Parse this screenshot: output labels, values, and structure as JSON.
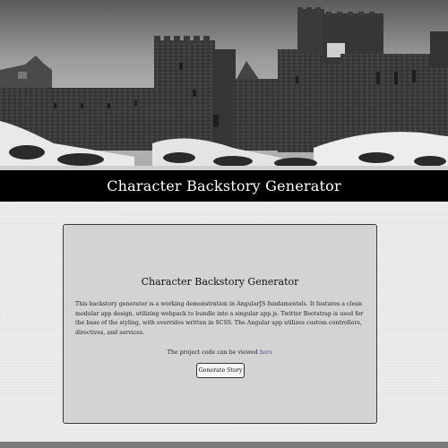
{
  "header": {
    "title": "Character Backstory Generator"
  },
  "hero": {
    "image": "castle-ruins-photo"
  },
  "card": {
    "title": "Character Backstory Generator",
    "description": "This backstory generator is a working demonstration in AngularJS fundamentals. It features a clean modular app design, utilizing webpack to bundle into a singular app.js. Twitter Bootstrap is used for the base of the styling, with overrides written in SCSS. The Angular app utilizes custom controllers, directives, and services.",
    "code_text": "The project code can be viewed",
    "code_link": "here",
    "button_label": "Generate Story"
  },
  "colors": {
    "title_bar_bg": "#000000",
    "card_bg": "#d3d3d3",
    "link": "#6a3fa0"
  }
}
